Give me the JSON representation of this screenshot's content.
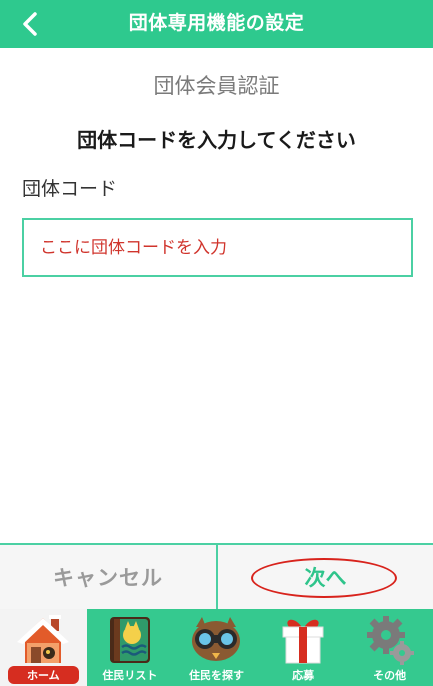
{
  "header": {
    "title": "団体専用機能の設定",
    "back_icon": "chevron-left-icon"
  },
  "main": {
    "section_title": "団体会員認証",
    "instruction": "団体コードを入力してください",
    "field_label": "団体コード",
    "input_value": "",
    "input_placeholder": "ここに団体コードを入力"
  },
  "actions": {
    "cancel_label": "キャンセル",
    "next_label": "次へ"
  },
  "tabs": [
    {
      "label": "ホーム",
      "icon": "house-icon",
      "active": true
    },
    {
      "label": "住民リスト",
      "icon": "book-icon",
      "active": false
    },
    {
      "label": "住民を探す",
      "icon": "binoculars-icon",
      "active": false
    },
    {
      "label": "応募",
      "icon": "gift-icon",
      "active": false
    },
    {
      "label": "その他",
      "icon": "gear-icon",
      "active": false
    }
  ],
  "colors": {
    "primary": "#2ec98e",
    "accent_red": "#d62d20",
    "placeholder": "#d0342c"
  }
}
